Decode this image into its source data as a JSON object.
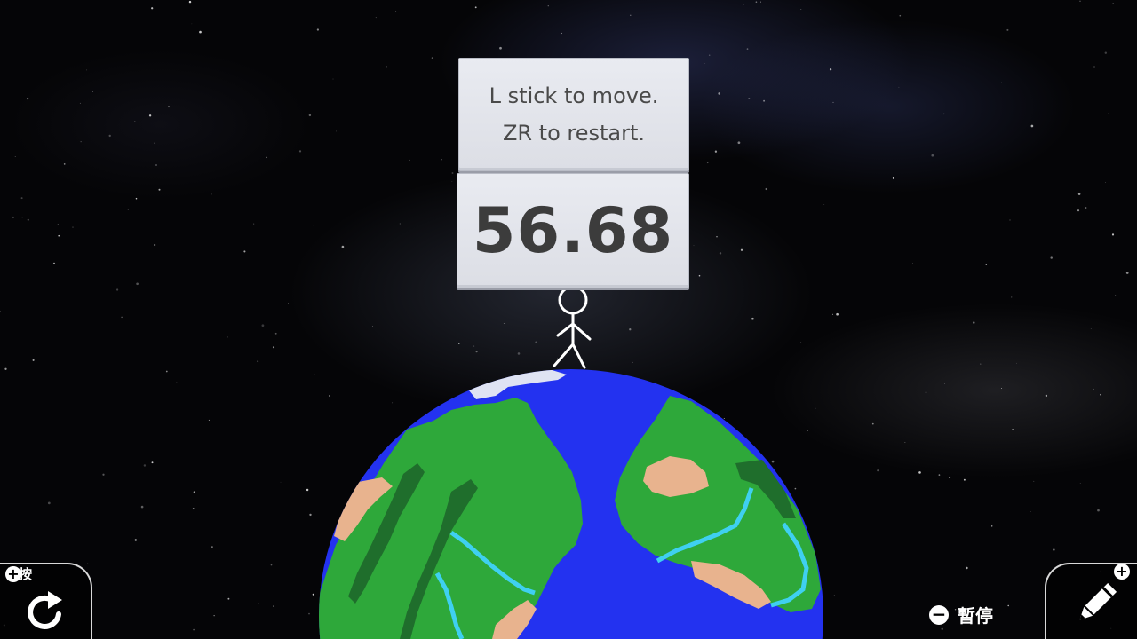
{
  "game": {
    "instructions": {
      "line1": "L stick to move.",
      "line2": "ZR to restart."
    },
    "timer": "56.68"
  },
  "hud": {
    "hold_label": "長按",
    "restart_icon": "restart-arrow-icon",
    "pause_label": "暫停",
    "edit_icon": "pencil-icon",
    "plus_symbol": "+",
    "minus_symbol": "−"
  },
  "colors": {
    "ocean": "#2332f0",
    "land": "#2ea83a",
    "forest": "#1f6e2c",
    "sand": "#e8b38e",
    "river": "#3fd0f0",
    "ice": "#dfe3f3",
    "sign": "#e6e8ee"
  }
}
